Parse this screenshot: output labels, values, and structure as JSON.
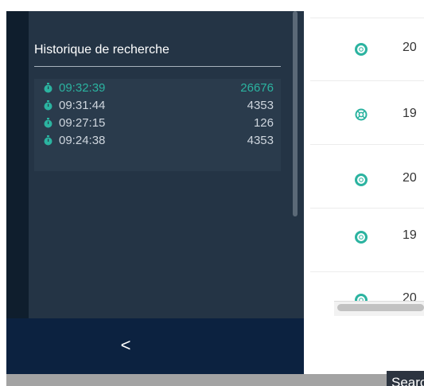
{
  "sidebar": {
    "history_title": "Historique de recherche",
    "history": [
      {
        "time": "09:32:39",
        "count": "26676",
        "active": true
      },
      {
        "time": "09:31:44",
        "count": "4353",
        "active": false
      },
      {
        "time": "09:27:15",
        "count": "126",
        "active": false
      },
      {
        "time": "09:24:38",
        "count": "4353",
        "active": false
      }
    ],
    "collapse_label": "<"
  },
  "list": {
    "rows": [
      {
        "icon": "lifebuoy-icon",
        "value": "20"
      },
      {
        "icon": "lifebuoy-icon",
        "value": "19"
      },
      {
        "icon": "lifebuoy-icon",
        "value": "20"
      },
      {
        "icon": "lifebuoy-icon",
        "value": "19"
      },
      {
        "icon": "lifebuoy-icon",
        "value": "20"
      }
    ]
  },
  "footer": {
    "search_label": "Search"
  },
  "colors": {
    "accent": "#2bb3a0",
    "sidebar_bg": "#243445",
    "footer_bg": "#0c2240"
  }
}
